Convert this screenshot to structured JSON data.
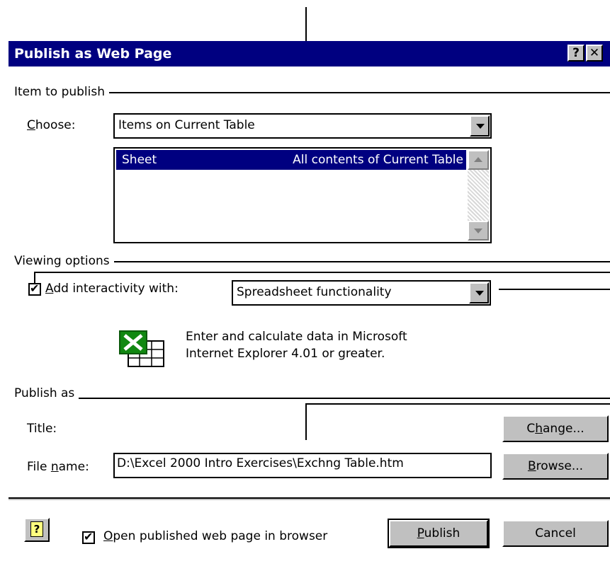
{
  "dialog": {
    "title": "Publish as Web Page",
    "help_glyph": "?",
    "close_glyph": "✕"
  },
  "item_to_publish": {
    "group_label": "Item to publish",
    "choose_label": "Choose:",
    "choose_value": "Items on Current Table",
    "list_items": [
      {
        "name": "Sheet",
        "description": "All contents of Current Table"
      }
    ]
  },
  "viewing_options": {
    "group_label": "Viewing options",
    "add_interactivity_label": "Add interactivity with:",
    "add_interactivity_checked": true,
    "interactivity_value": "Spreadsheet functionality",
    "description_line1": "Enter and calculate data in Microsoft",
    "description_line2": "Internet Explorer 4.01 or greater.",
    "icon": "excel-spreadsheet-icon"
  },
  "publish_as": {
    "group_label": "Publish as",
    "title_label": "Title:",
    "change_button": "Change...",
    "file_name_label": "File name:",
    "file_name_value": "D:\\Excel 2000 Intro Exercises\\Exchng Table.htm",
    "browse_button": "Browse..."
  },
  "footer": {
    "open_in_browser_label": "Open published web page in browser",
    "open_in_browser_checked": true,
    "publish_button": "Publish",
    "cancel_button": "Cancel",
    "help_icon": "question-mark-icon"
  },
  "colors": {
    "titlebar": "#000080",
    "selection": "#000080",
    "button_face": "#c0c0c0"
  }
}
